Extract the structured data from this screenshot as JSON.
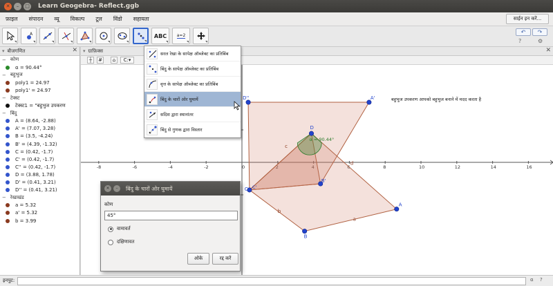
{
  "window": {
    "title": "Learn Geogebra- Reflect.ggb"
  },
  "menu": {
    "items": [
      "फ़ाइल",
      "संपादन",
      "व्यू",
      "विकल्प",
      "टूल",
      "विंडो",
      "सहायता"
    ],
    "signin": "साईन इन करें..."
  },
  "toolbar": {
    "tool_icons": [
      "move-icon",
      "point-icon",
      "line-icon",
      "perpendicular-icon",
      "polygon-icon",
      "circle-icon",
      "conic-icon",
      "reflect-icon",
      "text-icon",
      "slider-icon",
      "move-view-icon"
    ],
    "text_tool_label": "ABC",
    "slider_tool_label": "a=2"
  },
  "algebra": {
    "title": "बीजगणित",
    "rows": [
      {
        "kind": "cat",
        "label": "कोण"
      },
      {
        "kind": "obj",
        "label": "α = 90.44°",
        "color": "green"
      },
      {
        "kind": "cat",
        "label": "बहुभुज"
      },
      {
        "kind": "obj",
        "label": "poly1 = 24.97",
        "color": "brown"
      },
      {
        "kind": "obj",
        "label": "poly1' = 24.97",
        "color": "brown"
      },
      {
        "kind": "cat",
        "label": "टेक्स्ट"
      },
      {
        "kind": "obj",
        "label": "टेक्स्ट1 = \"बहुभुज उपकरण",
        "color": "black"
      },
      {
        "kind": "cat",
        "label": "बिंदु"
      },
      {
        "kind": "obj",
        "label": "A = (8.64, -2.88)",
        "color": "blue"
      },
      {
        "kind": "obj",
        "label": "A' = (7.07, 3.28)",
        "color": "blue"
      },
      {
        "kind": "obj",
        "label": "B = (3.5, -4.24)",
        "color": "blue"
      },
      {
        "kind": "obj",
        "label": "B' = (4.39, -1.32)",
        "color": "blue"
      },
      {
        "kind": "obj",
        "label": "C = (0.42, -1.7)",
        "color": "blue"
      },
      {
        "kind": "obj",
        "label": "C' = (0.42, -1.7)",
        "color": "blue"
      },
      {
        "kind": "obj",
        "label": "C'' = (0.42, -1.7)",
        "color": "blue"
      },
      {
        "kind": "obj",
        "label": "D = (3.88, 1.78)",
        "color": "blue"
      },
      {
        "kind": "obj",
        "label": "D' = (0.41, 3.21)",
        "color": "blue"
      },
      {
        "kind": "obj",
        "label": "D'' = (0.41, 3.21)",
        "color": "blue"
      },
      {
        "kind": "cat",
        "label": "रेखाखंड"
      },
      {
        "kind": "obj",
        "label": "a = 5.32",
        "color": "brown"
      },
      {
        "kind": "obj",
        "label": "a' = 5.32",
        "color": "brown"
      },
      {
        "kind": "obj",
        "label": "b = 3.99",
        "color": "brown"
      }
    ]
  },
  "graphics": {
    "title": "ग्राफ़िक्स",
    "style_btn": "C:",
    "annotation": "बहुभुज उपकरण आपको बहुभुज बनाने में मदद करता है",
    "axis_ticks_x": [
      "-8",
      "-6",
      "-4",
      "-2",
      "0",
      "2",
      "4",
      "6",
      "8",
      "10",
      "12",
      "14",
      "16"
    ],
    "axis_ticks_y": [
      "2",
      "-2"
    ],
    "points": [
      {
        "label": "D''"
      },
      {
        "label": "A'"
      },
      {
        "label": "D"
      },
      {
        "label": "B'"
      },
      {
        "label": "C"
      },
      {
        "label": "A"
      },
      {
        "label": "B"
      },
      {
        "label": "C'"
      }
    ],
    "segment_labels": {
      "c": "c",
      "d": "d",
      "b": "b",
      "a": "a"
    },
    "angle_label": "α = 90.44°"
  },
  "dropdown": {
    "items": [
      {
        "label": "सरल रेखा के सापेक्ष ऑब्जेक्ट का प्रतिबिंब",
        "icon": "reflect-line-icon"
      },
      {
        "label": "बिंदु के सापेक्ष ऑब्जेक्ट का प्रतिबिंब",
        "icon": "reflect-point-icon"
      },
      {
        "label": "वृत्त के सापेक्ष ऑब्जेक्ट का प्रतिबिंब",
        "icon": "reflect-circle-icon"
      },
      {
        "label": "बिंदु के चारों ओर घुमायें",
        "icon": "rotate-point-icon"
      },
      {
        "label": "सदिश द्वारा स्थानांतर",
        "icon": "translate-vector-icon"
      },
      {
        "label": "बिंदु से गुणक द्वारा विस्तार",
        "icon": "dilate-icon"
      }
    ]
  },
  "dialog": {
    "title": "बिंदु के चारों ओर घुमायें",
    "field_label": "कोण",
    "field_value": "45°",
    "radio_ccw": "वामावर्त",
    "radio_cw": "दक्षिणावत",
    "ok": "ओके",
    "cancel": "रद्द करें"
  },
  "inputbar": {
    "label": "इनपुट:"
  }
}
